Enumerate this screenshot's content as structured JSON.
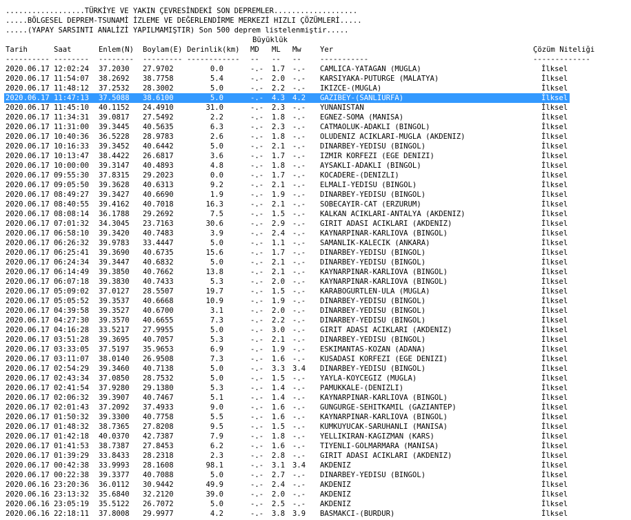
{
  "title_lines": [
    "..................TÜRKİYE VE YAKIN ÇEVRESİNDEKİ SON DEPREMLER...................",
    ".....BÖLGESEL DEPREM-TSUNAMİ İZLEME VE DEĞERLENDİRME MERKEZİ HIZLI ÇÖZÜMLERİ.....",
    ".....(YAPAY SARSINTI ANALİZİ YAPILMAMIŞTIR) Son 500 deprem listelenmiştir....."
  ],
  "magnitude_group": "Büyüklük",
  "headers": {
    "date": "Tarih",
    "time": "Saat",
    "lat": "Enlem(N)",
    "lon": "Boylam(E)",
    "depth": "Derinlik(km)",
    "md": "MD",
    "ml": "ML",
    "mw": "Mw",
    "location": "Yer",
    "solution": "Çözüm Niteliği"
  },
  "separators": {
    "date": "----------",
    "time": "--------",
    "lat": "--------",
    "lon": "---------",
    "depth": "------------",
    "md": "--",
    "ml": "--",
    "mw": "--",
    "location": "-----------",
    "solution": "-------------"
  },
  "selected_index": 3,
  "rows": [
    [
      "2020.06.17",
      "12:02:24",
      "37.2030",
      "27.9702",
      "0.0",
      "-.-",
      "1.7",
      "-.-",
      "CAMLICA-YATAGAN (MUGLA)",
      "İlksel"
    ],
    [
      "2020.06.17",
      "11:54:07",
      "38.2692",
      "38.7758",
      "5.4",
      "-.-",
      "2.0",
      "-.-",
      "KARSIYAKA-PUTURGE (MALATYA)",
      "İlksel"
    ],
    [
      "2020.06.17",
      "11:48:12",
      "37.2532",
      "28.3002",
      "5.0",
      "-.-",
      "2.2",
      "-.-",
      "IKIZCE-(MUGLA)",
      "İlksel"
    ],
    [
      "2020.06.17",
      "11:47:13",
      "37.5088",
      "38.6100",
      "5.0",
      "-.-",
      "4.3",
      "4.2",
      "GAZIBEY-(SANLIURFA)",
      "İlksel"
    ],
    [
      "2020.06.17",
      "11:45:10",
      "40.1152",
      "24.4910",
      "31.0",
      "-.-",
      "2.3",
      "-.-",
      "YUNANISTAN",
      "İlksel"
    ],
    [
      "2020.06.17",
      "11:34:31",
      "39.0817",
      "27.5492",
      "2.2",
      "-.-",
      "1.8",
      "-.-",
      "EGNEZ-SOMA (MANISA)",
      "İlksel"
    ],
    [
      "2020.06.17",
      "11:31:00",
      "39.3445",
      "40.5635",
      "6.3",
      "-.-",
      "2.3",
      "-.-",
      "CATMAOLUK-ADAKLI (BINGOL)",
      "İlksel"
    ],
    [
      "2020.06.17",
      "10:40:36",
      "36.5228",
      "28.9783",
      "2.6",
      "-.-",
      "1.8",
      "-.-",
      "OLUDENIZ ACIKLARI-MUGLA (AKDENIZ)",
      "İlksel"
    ],
    [
      "2020.06.17",
      "10:16:33",
      "39.3452",
      "40.6442",
      "5.0",
      "-.-",
      "2.1",
      "-.-",
      "DINARBEY-YEDISU (BINGOL)",
      "İlksel"
    ],
    [
      "2020.06.17",
      "10:13:47",
      "38.4422",
      "26.6817",
      "3.6",
      "-.-",
      "1.7",
      "-.-",
      "IZMIR KORFEZI (EGE DENIZI)",
      "İlksel"
    ],
    [
      "2020.06.17",
      "10:00:00",
      "39.3147",
      "40.4893",
      "4.8",
      "-.-",
      "1.8",
      "-.-",
      "AYSAKLI-ADAKLI (BINGOL)",
      "İlksel"
    ],
    [
      "2020.06.17",
      "09:55:30",
      "37.8315",
      "29.2023",
      "0.0",
      "-.-",
      "1.7",
      "-.-",
      "KOCADERE-(DENIZLI)",
      "İlksel"
    ],
    [
      "2020.06.17",
      "09:05:50",
      "39.3628",
      "40.6313",
      "9.2",
      "-.-",
      "2.1",
      "-.-",
      "ELMALI-YEDISU (BINGOL)",
      "İlksel"
    ],
    [
      "2020.06.17",
      "08:49:27",
      "39.3427",
      "40.6690",
      "1.9",
      "-.-",
      "1.9",
      "-.-",
      "DINARBEY-YEDISU (BINGOL)",
      "İlksel"
    ],
    [
      "2020.06.17",
      "08:40:55",
      "39.4162",
      "40.7018",
      "16.3",
      "-.-",
      "2.1",
      "-.-",
      "SOBECAYIR-CAT (ERZURUM)",
      "İlksel"
    ],
    [
      "2020.06.17",
      "08:08:14",
      "36.1788",
      "29.2692",
      "7.5",
      "-.-",
      "1.5",
      "-.-",
      "KALKAN ACIKLARI-ANTALYA (AKDENIZ)",
      "İlksel"
    ],
    [
      "2020.06.17",
      "07:01:32",
      "34.3045",
      "23.7163",
      "30.6",
      "-.-",
      "2.9",
      "-.-",
      "GIRIT ADASI ACIKLARI (AKDENIZ)",
      "İlksel"
    ],
    [
      "2020.06.17",
      "06:58:10",
      "39.3420",
      "40.7483",
      "3.9",
      "-.-",
      "2.4",
      "-.-",
      "KAYNARPINAR-KARLIOVA (BINGOL)",
      "İlksel"
    ],
    [
      "2020.06.17",
      "06:26:32",
      "39.9783",
      "33.4447",
      "5.0",
      "-.-",
      "1.1",
      "-.-",
      "SAMANLIK-KALECIK (ANKARA)",
      "İlksel"
    ],
    [
      "2020.06.17",
      "06:25:41",
      "39.3690",
      "40.6735",
      "15.6",
      "-.-",
      "1.7",
      "-.-",
      "DINARBEY-YEDISU (BINGOL)",
      "İlksel"
    ],
    [
      "2020.06.17",
      "06:24:34",
      "39.3447",
      "40.6832",
      "5.0",
      "-.-",
      "2.1",
      "-.-",
      "DINARBEY-YEDISU (BINGOL)",
      "İlksel"
    ],
    [
      "2020.06.17",
      "06:14:49",
      "39.3850",
      "40.7662",
      "13.8",
      "-.-",
      "2.1",
      "-.-",
      "KAYNARPINAR-KARLIOVA (BINGOL)",
      "İlksel"
    ],
    [
      "2020.06.17",
      "06:07:18",
      "39.3830",
      "40.7433",
      "5.3",
      "-.-",
      "2.0",
      "-.-",
      "KAYNARPINAR-KARLIOVA (BINGOL)",
      "İlksel"
    ],
    [
      "2020.06.17",
      "05:09:02",
      "37.0127",
      "28.5507",
      "19.7",
      "-.-",
      "1.5",
      "-.-",
      "KARABOGURTLEN-ULA (MUGLA)",
      "İlksel"
    ],
    [
      "2020.06.17",
      "05:05:52",
      "39.3537",
      "40.6668",
      "10.9",
      "-.-",
      "1.9",
      "-.-",
      "DINARBEY-YEDISU (BINGOL)",
      "İlksel"
    ],
    [
      "2020.06.17",
      "04:39:58",
      "39.3527",
      "40.6700",
      "3.1",
      "-.-",
      "2.0",
      "-.-",
      "DINARBEY-YEDISU (BINGOL)",
      "İlksel"
    ],
    [
      "2020.06.17",
      "04:27:30",
      "39.3570",
      "40.6655",
      "7.3",
      "-.-",
      "2.2",
      "-.-",
      "DINARBEY-YEDISU (BINGOL)",
      "İlksel"
    ],
    [
      "2020.06.17",
      "04:16:28",
      "33.5217",
      "27.9955",
      "5.0",
      "-.-",
      "3.0",
      "-.-",
      "GIRIT ADASI ACIKLARI (AKDENIZ)",
      "İlksel"
    ],
    [
      "2020.06.17",
      "03:51:28",
      "39.3695",
      "40.7057",
      "5.3",
      "-.-",
      "2.1",
      "-.-",
      "DINARBEY-YEDISU (BINGOL)",
      "İlksel"
    ],
    [
      "2020.06.17",
      "03:33:05",
      "37.5197",
      "35.9653",
      "6.9",
      "-.-",
      "1.9",
      "-.-",
      "ESKIMANTAS-KOZAN (ADANA)",
      "İlksel"
    ],
    [
      "2020.06.17",
      "03:11:07",
      "38.0140",
      "26.9508",
      "7.3",
      "-.-",
      "1.6",
      "-.-",
      "KUSADASI KORFEZI (EGE DENIZI)",
      "İlksel"
    ],
    [
      "2020.06.17",
      "02:54:29",
      "39.3460",
      "40.7138",
      "5.0",
      "-.-",
      "3.3",
      "3.4",
      "DINARBEY-YEDISU (BINGOL)",
      "İlksel"
    ],
    [
      "2020.06.17",
      "02:43:34",
      "37.0850",
      "28.7532",
      "5.0",
      "-.-",
      "1.5",
      "-.-",
      "YAYLA-KOYCEGIZ (MUGLA)",
      "İlksel"
    ],
    [
      "2020.06.17",
      "02:41:54",
      "37.9280",
      "29.1380",
      "5.3",
      "-.-",
      "1.4",
      "-.-",
      "PAMUKKALE-(DENIZLI)",
      "İlksel"
    ],
    [
      "2020.06.17",
      "02:06:32",
      "39.3907",
      "40.7467",
      "5.1",
      "-.-",
      "1.4",
      "-.-",
      "KAYNARPINAR-KARLIOVA (BINGOL)",
      "İlksel"
    ],
    [
      "2020.06.17",
      "02:01:43",
      "37.2092",
      "37.4933",
      "9.0",
      "-.-",
      "1.6",
      "-.-",
      "GUNGURGE-SEHITKAMIL (GAZIANTEP)",
      "İlksel"
    ],
    [
      "2020.06.17",
      "01:50:32",
      "39.3300",
      "40.7758",
      "5.5",
      "-.-",
      "1.6",
      "-.-",
      "KAYNARPINAR-KARLIOVA (BINGOL)",
      "İlksel"
    ],
    [
      "2020.06.17",
      "01:48:32",
      "38.7365",
      "27.8208",
      "9.5",
      "-.-",
      "1.5",
      "-.-",
      "KUMKUYUCAK-SARUHANLI (MANISA)",
      "İlksel"
    ],
    [
      "2020.06.17",
      "01:42:18",
      "40.0370",
      "42.7387",
      "7.9",
      "-.-",
      "1.8",
      "-.-",
      "YELLIKIRAN-KAGIZMAN (KARS)",
      "İlksel"
    ],
    [
      "2020.06.17",
      "01:41:53",
      "38.7387",
      "27.8453",
      "6.2",
      "-.-",
      "1.6",
      "-.-",
      "TIYENLI-GOLMARMARA (MANISA)",
      "İlksel"
    ],
    [
      "2020.06.17",
      "01:39:29",
      "33.8433",
      "28.2318",
      "2.3",
      "-.-",
      "2.8",
      "-.-",
      "GIRIT ADASI ACIKLARI (AKDENIZ)",
      "İlksel"
    ],
    [
      "2020.06.17",
      "00:42:38",
      "33.9993",
      "28.1608",
      "98.1",
      "-.-",
      "3.1",
      "3.4",
      "AKDENIZ",
      "İlksel"
    ],
    [
      "2020.06.17",
      "00:22:38",
      "39.3377",
      "40.7088",
      "5.0",
      "-.-",
      "2.7",
      "-.-",
      "DINARBEY-YEDISU (BINGOL)",
      "İlksel"
    ],
    [
      "2020.06.16",
      "23:20:36",
      "36.0112",
      "30.9442",
      "49.9",
      "-.-",
      "2.4",
      "-.-",
      "AKDENIZ",
      "İlksel"
    ],
    [
      "2020.06.16",
      "23:13:32",
      "35.6840",
      "32.2120",
      "39.0",
      "-.-",
      "2.0",
      "-.-",
      "AKDENIZ",
      "İlksel"
    ],
    [
      "2020.06.16",
      "23:05:19",
      "35.5122",
      "26.7072",
      "5.0",
      "-.-",
      "2.5",
      "-.-",
      "AKDENIZ",
      "İlksel"
    ],
    [
      "2020.06.16",
      "22:18:11",
      "37.8008",
      "29.9977",
      "4.2",
      "-.-",
      "3.8",
      "3.9",
      "BASMAKCI-(BURDUR)",
      "İlksel"
    ]
  ]
}
